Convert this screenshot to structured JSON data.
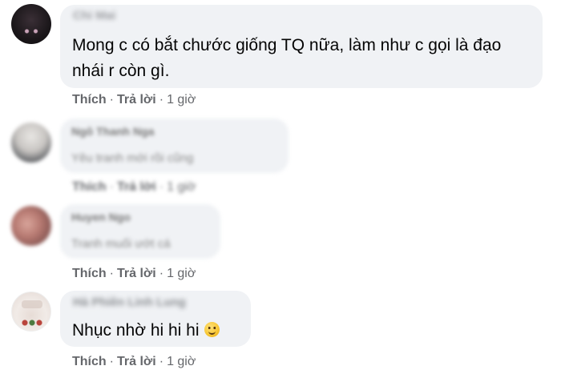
{
  "comments": [
    {
      "author": "Chi Mai",
      "text": "Mong c có bắt chước giống TQ nữa, làm như c gọi là đạo nhái r còn gì.",
      "like": "Thích",
      "reply": "Trả lời",
      "time": "1 giờ"
    },
    {
      "author": "Ngô Thanh Nga",
      "text": "Yêu tranh mới rồi cũng",
      "like": "Thích",
      "reply": "Trả lời",
      "time": "1 giờ"
    },
    {
      "author": "Huyen Ngo",
      "text": "Tranh muối ướt cá",
      "like": "Thích",
      "reply": "Trả lời",
      "time": "1 giờ"
    },
    {
      "author": "Hà Phiên Linh Lung",
      "text": "Nhục nhờ hi hi hi",
      "emoji": "slightly-smiling-face",
      "like": "Thích",
      "reply": "Trả lời",
      "time": "1 giờ"
    }
  ],
  "separator": "·",
  "colors": {
    "bubble": "#f0f2f5",
    "text": "#050505",
    "meta": "#65676b"
  }
}
